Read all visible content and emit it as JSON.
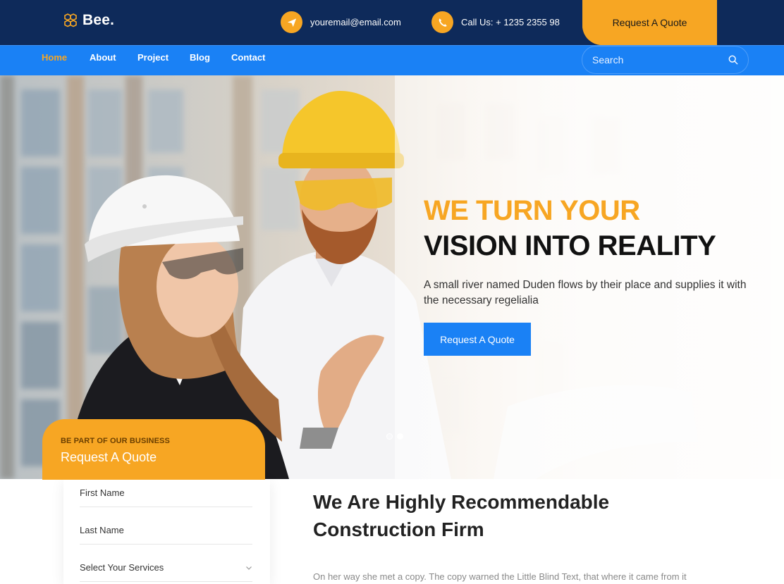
{
  "brand": {
    "name": "Bee."
  },
  "topbar": {
    "email": "youremail@email.com",
    "phone": "Call Us: + 1235 2355 98",
    "quote_button": "Request A Quote"
  },
  "nav": {
    "items": [
      {
        "label": "Home",
        "active": true
      },
      {
        "label": "About"
      },
      {
        "label": "Project"
      },
      {
        "label": "Blog"
      },
      {
        "label": "Contact"
      }
    ],
    "search_placeholder": "Search"
  },
  "hero": {
    "headline_line1": "WE TURN YOUR",
    "headline_line2": "VISION INTO REALITY",
    "description": "A small river named Duden flows by their place and supplies it with the necessary regelialia",
    "button": "Request A Quote",
    "slides": 2,
    "active_slide": 2
  },
  "quote_form": {
    "eyebrow": "BE PART OF OUR BUSINESS",
    "title": "Request A Quote",
    "fields": [
      {
        "label": "First Name"
      },
      {
        "label": "Last Name"
      },
      {
        "label": "Select Your Services"
      }
    ]
  },
  "about": {
    "title_line1": "We Are Highly Recommendable",
    "title_line2": "Construction Firm",
    "text": "On her way she met a copy. The copy warned the Little Blind Text, that where it came from it"
  },
  "colors": {
    "navy": "#0e2a5a",
    "blue": "#1a81f5",
    "orange": "#f7a623"
  }
}
